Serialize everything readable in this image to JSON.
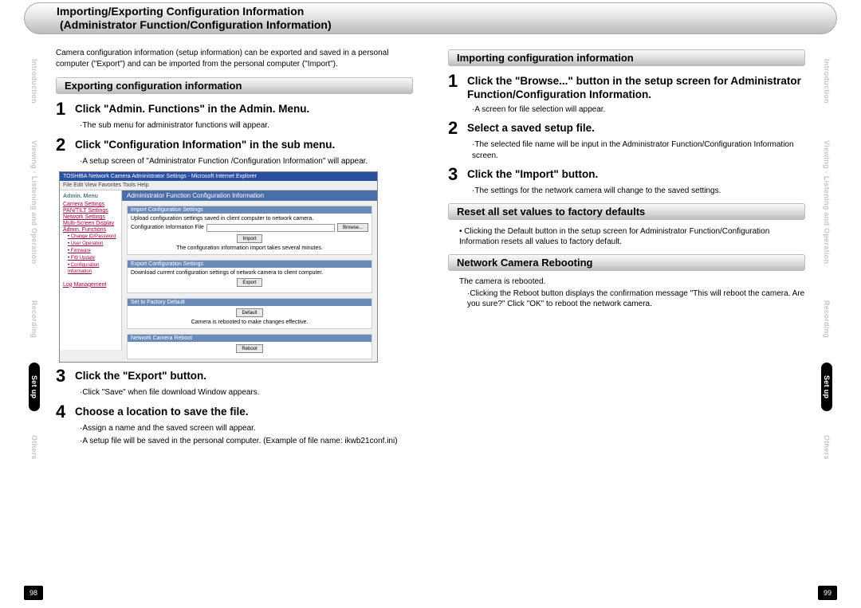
{
  "header": {
    "line1": "Importing/Exporting Configuration Information",
    "line2": "(Administrator Function/Configuration Information)"
  },
  "left": {
    "intro": "Camera configuration information (setup information) can be exported and saved in a personal computer (\"Export\") and can be imported from the personal computer (\"Import\").",
    "exporting_hd": "Exporting configuration information",
    "s1": "Click \"Admin. Functions\" in the Admin. Menu.",
    "s1_sub": "The sub menu for administrator functions will appear.",
    "s2": "Click \"Configuration Information\" in the sub menu.",
    "s2_sub": "A setup screen of \"Administrator Function /Configuration Information\" will appear.",
    "s3": "Click the \"Export\" button.",
    "s3_sub": "Click \"Save\" when file download Window appears.",
    "s4": "Choose a location to save the file.",
    "s4_sub1": "Assign a name and the saved screen will appear.",
    "s4_sub2": "A setup file will be saved in the personal computer.  (Example of file name: ikwb21conf.ini)"
  },
  "right": {
    "importing_hd": "Importing configuration information",
    "s1": "Click the \"Browse...\" button in the setup screen for Administrator Function/Configuration Information.",
    "s1_sub": "A screen for file selection will appear.",
    "s2": "Select a saved setup file.",
    "s2_sub": "The selected file name will be input in the Administrator Function/Configuration Information screen.",
    "s3": "Click the \"Import\" button.",
    "s3_sub": "The settings for the network camera will change to the saved settings.",
    "reset_hd": "Reset all set values to factory defaults",
    "reset_sub": "Clicking the Default button in the setup screen for Administrator Function/Configuration Information resets all values to factory default.",
    "reboot_hd": "Network Camera Rebooting",
    "reboot_txt": "The camera is rebooted.",
    "reboot_sub": "Clicking the Reboot button displays the confirmation message \"This will reboot the camera. Are you sure?\"  Click \"OK\" to reboot the network camera."
  },
  "tabs": {
    "t1": "Introduction",
    "t2": "Viewing · Listening and Operation",
    "t3": "Recording",
    "t4": "Set up",
    "t5": "Others"
  },
  "pages": {
    "left": "98",
    "right": "99"
  },
  "screenshot": {
    "title": "TOSHIBA Network Camera Administrator Settings - Microsoft Internet Explorer",
    "menu": "File  Edit  View  Favorites  Tools  Help",
    "side_header": "Admin. Menu",
    "side_items": [
      "Camera Settings",
      "PAN/TILT Settings",
      "Network Settings",
      "Multi-Screen Display",
      "Admin. Functions"
    ],
    "side_sub": [
      "Change ID/Password",
      "User Operation",
      "Firmware",
      "FW Update",
      "Configuration Information"
    ],
    "side_log": "Log Management",
    "main_header": "Administrator Function  Configuration Information",
    "box1_h": "Import Configuration Settings",
    "box1_line": "Upload configuration settings saved in client computer to network camera.",
    "box1_label": "Configuration Information File",
    "browse": "Browse...",
    "import": "Import",
    "box1_note": "The configuration information import takes several minutes.",
    "box2_h": "Export Configuration Settings",
    "box2_line": "Download current configuration settings of network camera to client computer.",
    "export": "Export",
    "box3_h": "Set to Factory Default",
    "default": "Default",
    "box3_note": "Camera is rebooted to make changes effective.",
    "box4_h": "Network Camera Reboot",
    "reboot": "Reboot"
  }
}
